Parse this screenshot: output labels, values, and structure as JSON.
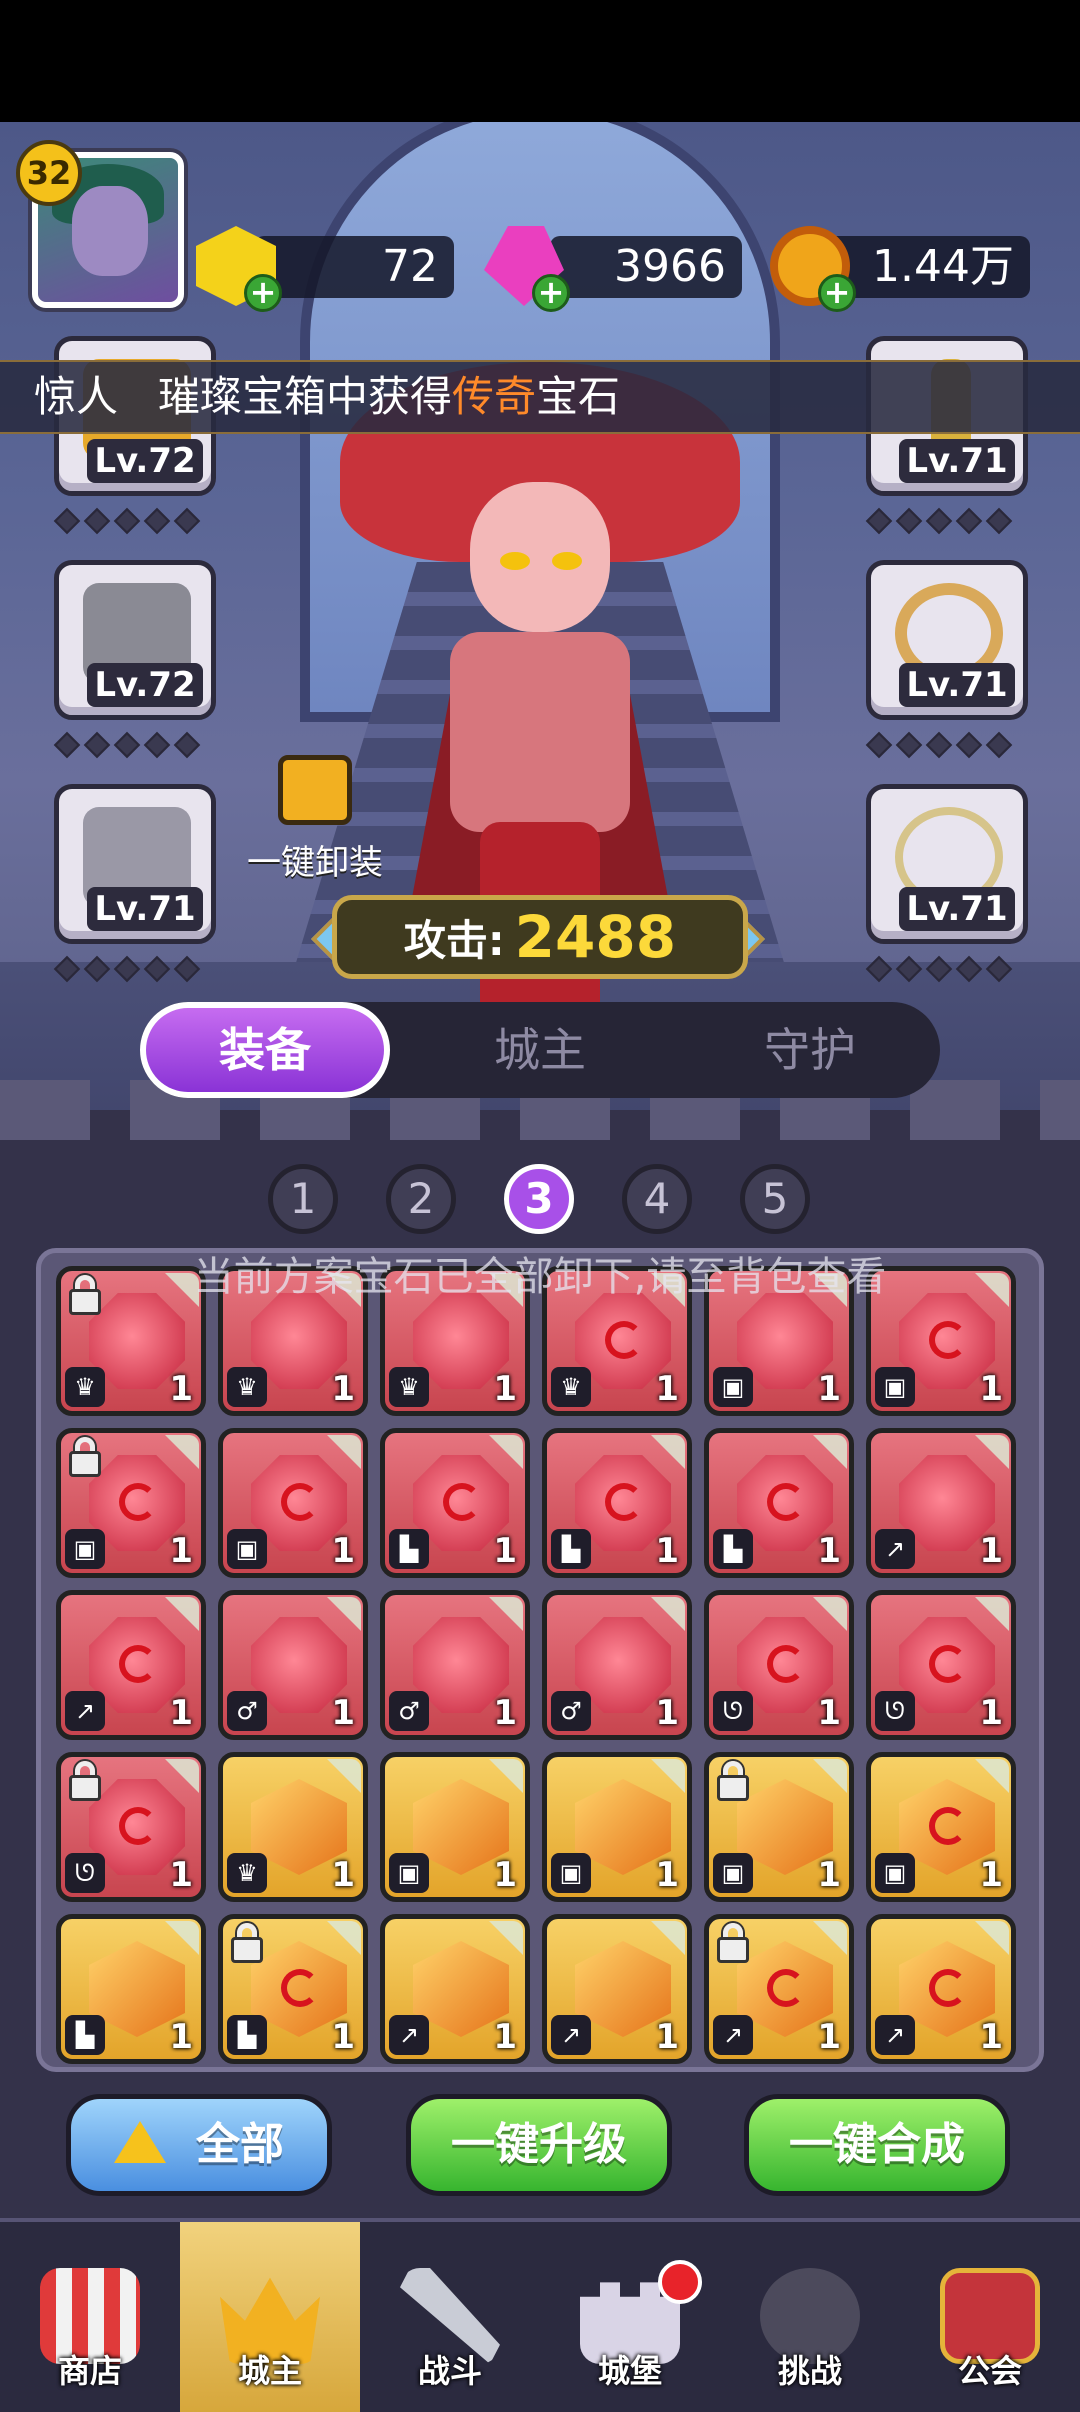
{
  "player": {
    "level": "32"
  },
  "resources": [
    {
      "name": "gold-gem",
      "value": "72"
    },
    {
      "name": "pink-diamond",
      "value": "3966"
    },
    {
      "name": "coin",
      "value": "1.44万"
    }
  ],
  "marquee": {
    "prefix": "惊人",
    "middle": "璀璨宝箱中获得",
    "highlight": "传奇",
    "suffix": "宝石"
  },
  "equipment": {
    "left": [
      {
        "icon": "crown-icon",
        "level": "Lv.72"
      },
      {
        "icon": "armor-icon",
        "level": "Lv.72"
      },
      {
        "icon": "boot-icon",
        "level": "Lv.71"
      }
    ],
    "right": [
      {
        "icon": "staff-icon",
        "level": "Lv.71"
      },
      {
        "icon": "ring-icon",
        "level": "Lv.71"
      },
      {
        "icon": "necklace-icon",
        "level": "Lv.71"
      }
    ]
  },
  "unequip_label": "一键卸装",
  "attack": {
    "label": "攻击:",
    "value": "2488"
  },
  "tabs": [
    "装备",
    "城主",
    "守护"
  ],
  "plans": [
    "1",
    "2",
    "3",
    "4",
    "5"
  ],
  "active_plan": "3",
  "notice": "当前方案宝石已全部卸下,请至背包查看",
  "gems": [
    {
      "c": "red",
      "swirl": false,
      "lock": true,
      "type": "♛",
      "count": "1"
    },
    {
      "c": "red",
      "swirl": false,
      "lock": false,
      "type": "♛",
      "count": "1"
    },
    {
      "c": "red",
      "swirl": false,
      "lock": false,
      "type": "♛",
      "count": "1"
    },
    {
      "c": "red",
      "swirl": true,
      "lock": false,
      "type": "♛",
      "count": "1"
    },
    {
      "c": "red",
      "swirl": false,
      "lock": false,
      "type": "▣",
      "count": "1"
    },
    {
      "c": "red",
      "swirl": true,
      "lock": false,
      "type": "▣",
      "count": "1"
    },
    {
      "c": "red",
      "swirl": true,
      "lock": true,
      "type": "▣",
      "count": "1"
    },
    {
      "c": "red",
      "swirl": true,
      "lock": false,
      "type": "▣",
      "count": "1"
    },
    {
      "c": "red",
      "swirl": true,
      "lock": false,
      "type": "▙",
      "count": "1"
    },
    {
      "c": "red",
      "swirl": true,
      "lock": false,
      "type": "▙",
      "count": "1"
    },
    {
      "c": "red",
      "swirl": true,
      "lock": false,
      "type": "▙",
      "count": "1"
    },
    {
      "c": "red",
      "swirl": false,
      "lock": false,
      "type": "↗",
      "count": "1"
    },
    {
      "c": "red",
      "swirl": true,
      "lock": false,
      "type": "↗",
      "count": "1"
    },
    {
      "c": "red",
      "swirl": false,
      "lock": false,
      "type": "♂",
      "count": "1"
    },
    {
      "c": "red",
      "swirl": false,
      "lock": false,
      "type": "♂",
      "count": "1"
    },
    {
      "c": "red",
      "swirl": false,
      "lock": false,
      "type": "♂",
      "count": "1"
    },
    {
      "c": "red",
      "swirl": true,
      "lock": false,
      "type": "ᘎ",
      "count": "1"
    },
    {
      "c": "red",
      "swirl": true,
      "lock": false,
      "type": "ᘎ",
      "count": "1"
    },
    {
      "c": "red",
      "swirl": true,
      "lock": true,
      "type": "ᘎ",
      "count": "1"
    },
    {
      "c": "gold",
      "swirl": false,
      "lock": false,
      "type": "♛",
      "count": "1"
    },
    {
      "c": "gold",
      "swirl": false,
      "lock": false,
      "type": "▣",
      "count": "1"
    },
    {
      "c": "gold",
      "swirl": false,
      "lock": false,
      "type": "▣",
      "count": "1"
    },
    {
      "c": "gold",
      "swirl": false,
      "lock": true,
      "type": "▣",
      "count": "1"
    },
    {
      "c": "gold",
      "swirl": true,
      "lock": false,
      "type": "▣",
      "count": "1"
    },
    {
      "c": "gold",
      "swirl": false,
      "lock": false,
      "type": "▙",
      "count": "1"
    },
    {
      "c": "gold",
      "swirl": true,
      "lock": true,
      "type": "▙",
      "count": "1"
    },
    {
      "c": "gold",
      "swirl": false,
      "lock": false,
      "type": "↗",
      "count": "1"
    },
    {
      "c": "gold",
      "swirl": false,
      "lock": false,
      "type": "↗",
      "count": "1"
    },
    {
      "c": "gold",
      "swirl": true,
      "lock": true,
      "type": "↗",
      "count": "1"
    },
    {
      "c": "gold",
      "swirl": true,
      "lock": false,
      "type": "↗",
      "count": "1"
    }
  ],
  "buttons": {
    "all": "全部",
    "upgrade": "一键升级",
    "merge": "一键合成"
  },
  "nav": [
    {
      "label": "商店",
      "icon": "shop-icon"
    },
    {
      "label": "城主",
      "icon": "lord-icon"
    },
    {
      "label": "战斗",
      "icon": "battle-icon"
    },
    {
      "label": "城堡",
      "icon": "castle-icon"
    },
    {
      "label": "挑战",
      "icon": "challenge-icon"
    },
    {
      "label": "公会",
      "icon": "guild-icon"
    }
  ],
  "nav_active": "城主",
  "colors": {
    "tab_active": "#a850e8",
    "highlight": "#ff8a2a",
    "attack_value": "#fcd93a"
  }
}
